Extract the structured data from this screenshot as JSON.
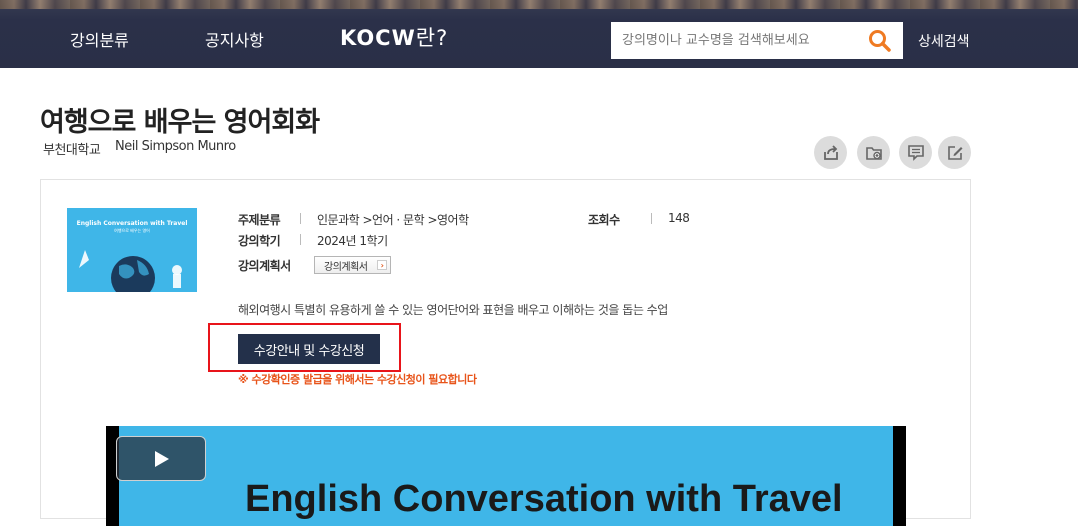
{
  "header": {
    "nav": [
      "강의분류",
      "공지사항"
    ],
    "logo_text": "KOCW",
    "logo_suffix": "란?",
    "search_placeholder": "강의명이나 교수명을 검색해보세요",
    "advanced_search": "상세검색",
    "accent_color": "#ef7a22"
  },
  "course": {
    "title": "여행으로 배우는 영어회화",
    "school": "부천대학교",
    "professor": "Neil Simpson Munro",
    "thumbnail": {
      "title": "English Conversation with Travel",
      "subtitle": "여행으로 배우는 영어"
    },
    "meta": {
      "subject_label": "주제분류",
      "subject_value": "인문과학 >언어 · 문학 >영어학",
      "views_label": "조회수",
      "views_value": "148",
      "semester_label": "강의학기",
      "semester_value": "2024년 1학기",
      "plan_label": "강의계획서",
      "plan_button": "강의계획서"
    },
    "description": "해외여행시 특별히 유용하게 쓸 수 있는 영어단어와 표현을 배우고 이해하는 것을 돕는 수업",
    "enroll_button": "수강안내 및 수강신청",
    "notice": "※ 수강확인증 발급을 위해서는 수강신청이 필요합니다",
    "video_title_partial": "English Conversation with Travel"
  },
  "actions": [
    "share-icon",
    "folder-add-icon",
    "comment-icon",
    "edit-icon"
  ]
}
